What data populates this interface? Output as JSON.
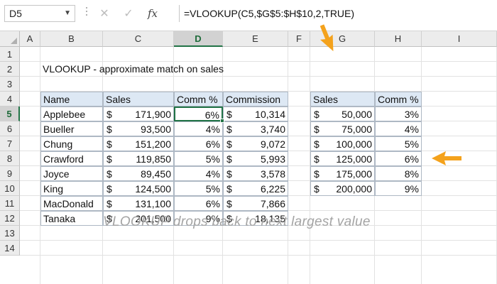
{
  "formula_bar": {
    "name_box": "D5",
    "cancel_icon": "cancel-icon",
    "enter_icon": "check-icon",
    "fx_label": "fx",
    "formula": "=VLOOKUP(C5,$G$5:$H$10,2,TRUE)"
  },
  "columns": [
    "A",
    "B",
    "C",
    "D",
    "E",
    "F",
    "G",
    "H",
    "I"
  ],
  "rows": [
    "1",
    "2",
    "3",
    "4",
    "5",
    "6",
    "7",
    "8",
    "9",
    "10",
    "11",
    "12",
    "13",
    "14"
  ],
  "selected_cell": "D5",
  "sheet": {
    "title": "VLOOKUP - approximate match on sales",
    "main_table": {
      "headers": [
        "Name",
        "Sales",
        "Comm %",
        "Commission"
      ],
      "currency_symbol": "$",
      "rows": [
        {
          "name": "Applebee",
          "sales": "171,900",
          "comm": "6%",
          "commission": "10,314"
        },
        {
          "name": "Bueller",
          "sales": "93,500",
          "comm": "4%",
          "commission": "3,740"
        },
        {
          "name": "Chung",
          "sales": "151,200",
          "comm": "6%",
          "commission": "9,072"
        },
        {
          "name": "Crawford",
          "sales": "119,850",
          "comm": "5%",
          "commission": "5,993"
        },
        {
          "name": "Joyce",
          "sales": "89,450",
          "comm": "4%",
          "commission": "3,578"
        },
        {
          "name": "King",
          "sales": "124,500",
          "comm": "5%",
          "commission": "6,225"
        },
        {
          "name": "MacDonald",
          "sales": "131,100",
          "comm": "6%",
          "commission": "7,866"
        },
        {
          "name": "Tanaka",
          "sales": "201,500",
          "comm": "9%",
          "commission": "18,135"
        }
      ]
    },
    "lookup_table": {
      "headers": [
        "Sales",
        "Comm %"
      ],
      "currency_symbol": "$",
      "rows": [
        {
          "sales": "50,000",
          "comm": "3%"
        },
        {
          "sales": "75,000",
          "comm": "4%"
        },
        {
          "sales": "100,000",
          "comm": "5%"
        },
        {
          "sales": "125,000",
          "comm": "6%"
        },
        {
          "sales": "175,000",
          "comm": "8%"
        },
        {
          "sales": "200,000",
          "comm": "9%"
        }
      ]
    },
    "note": "VLOOKUP drops back to next largest value"
  },
  "accent_colors": {
    "arrow": "#f4a21c",
    "selection": "#217346",
    "header_fill": "#dde8f4"
  }
}
